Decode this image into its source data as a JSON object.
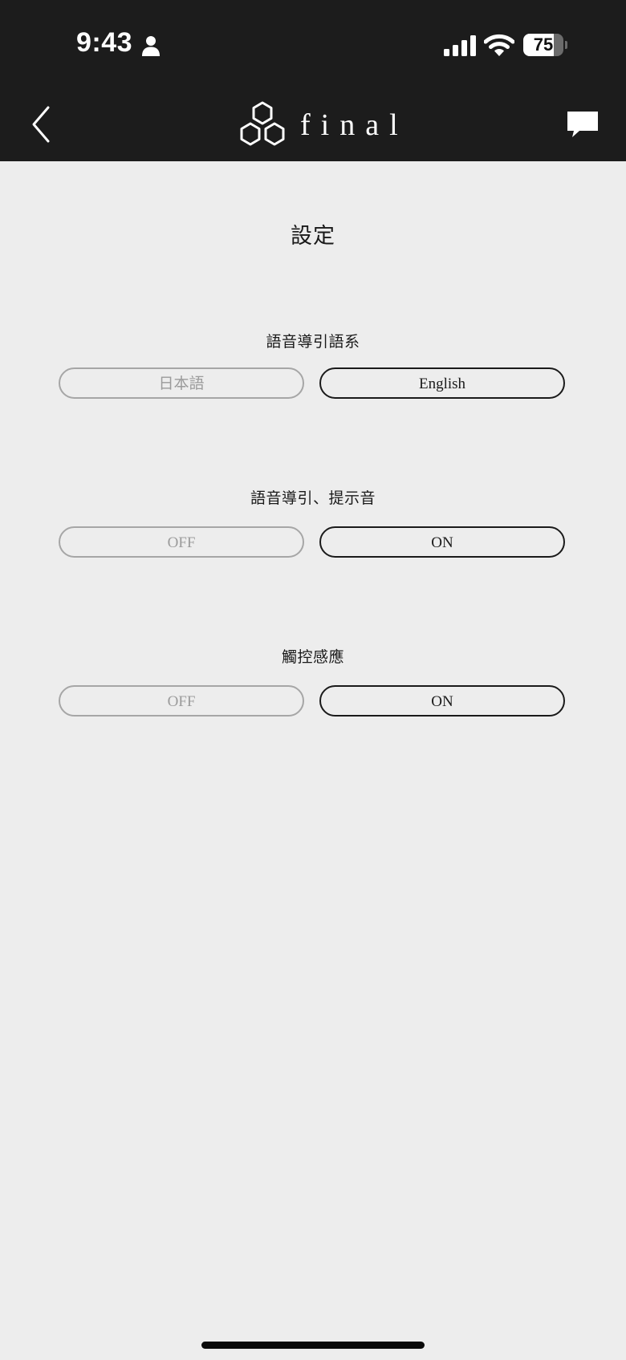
{
  "status_bar": {
    "time": "9:43",
    "battery_percent": "75",
    "battery_level": 0.75,
    "icons": [
      "person-icon",
      "cellular-signal-icon",
      "wifi-icon",
      "battery-icon"
    ]
  },
  "nav": {
    "back_icon": "chevron-left-icon",
    "logo_text": "final",
    "logo_icon": "hexagon-cluster-logo",
    "chat_icon": "chat-bubble-icon"
  },
  "page": {
    "title": "設定"
  },
  "sections": [
    {
      "label": "語音導引語系",
      "options": [
        {
          "label": "日本語",
          "selected": false
        },
        {
          "label": "English",
          "selected": true
        }
      ]
    },
    {
      "label": "語音導引、提示音",
      "options": [
        {
          "label": "OFF",
          "selected": false
        },
        {
          "label": "ON",
          "selected": true
        }
      ]
    },
    {
      "label": "觸控感應",
      "options": [
        {
          "label": "OFF",
          "selected": false
        },
        {
          "label": "ON",
          "selected": true
        }
      ]
    }
  ],
  "colors": {
    "header_bg": "#1c1c1c",
    "page_bg": "#ededed",
    "selected_border": "#1a1a1a",
    "unselected_border": "#a6a6a6",
    "unselected_text": "#9b9b9b"
  }
}
